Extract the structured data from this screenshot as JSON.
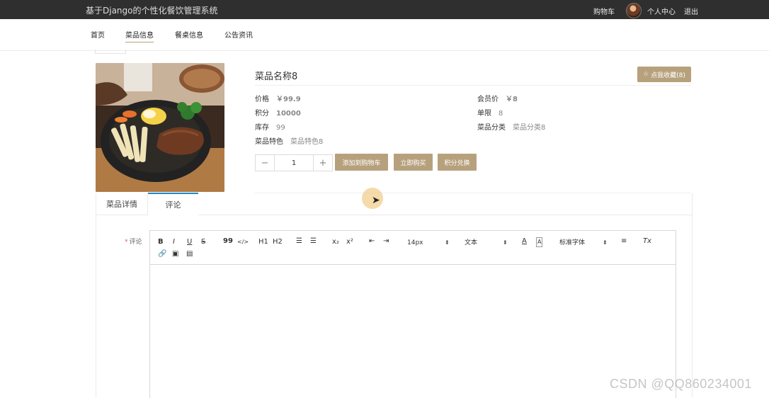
{
  "header": {
    "system_title": "基于Django的个性化餐饮管理系统",
    "cart": "购物车",
    "user_center": "个人中心",
    "logout": "退出"
  },
  "nav": {
    "items": [
      {
        "label": "首页"
      },
      {
        "label": "菜品信息"
      },
      {
        "label": "餐桌信息"
      },
      {
        "label": "公告资讯"
      }
    ],
    "active": "菜品信息"
  },
  "product": {
    "name": "菜品名称8",
    "favorite_button": "点我收藏(8)",
    "price_label": "价格",
    "price_value": "￥99.9",
    "member_price_label": "会员价",
    "member_price_value": "￥8",
    "points_label": "积分",
    "points_value": "10000",
    "limit_label": "单限",
    "limit_value": "8",
    "stock_label": "库存",
    "stock_value": "99",
    "category_label": "菜品分类",
    "category_value": "菜品分类8",
    "feature_label": "菜品特色",
    "feature_value": "菜品特色8"
  },
  "quantity": {
    "minus": "−",
    "value": "1",
    "plus": "+"
  },
  "actions": {
    "add_to_cart": "添加到购物车",
    "buy_now": "立即购买",
    "points_exchange": "积分兑换"
  },
  "tabs": {
    "details": "菜品详情",
    "comment": "评论"
  },
  "comment_form": {
    "required_mark": "*",
    "label": "评论",
    "font_size": "14px",
    "text_style": "文本",
    "font_family": "标准字体"
  },
  "toolbar_icons": {
    "bold": "B",
    "italic": "I",
    "underline": "U",
    "strike": "S",
    "quote": "99",
    "code": "</>",
    "h1": "H1",
    "h2": "H2",
    "sub": "x₂",
    "sup": "x²",
    "clear": "Tx"
  },
  "watermark": "CSDN @QQ860234001",
  "colors": {
    "accent": "#b7a17d",
    "topbar": "#2f2f2f",
    "active_tab_border": "#1e88c7"
  }
}
